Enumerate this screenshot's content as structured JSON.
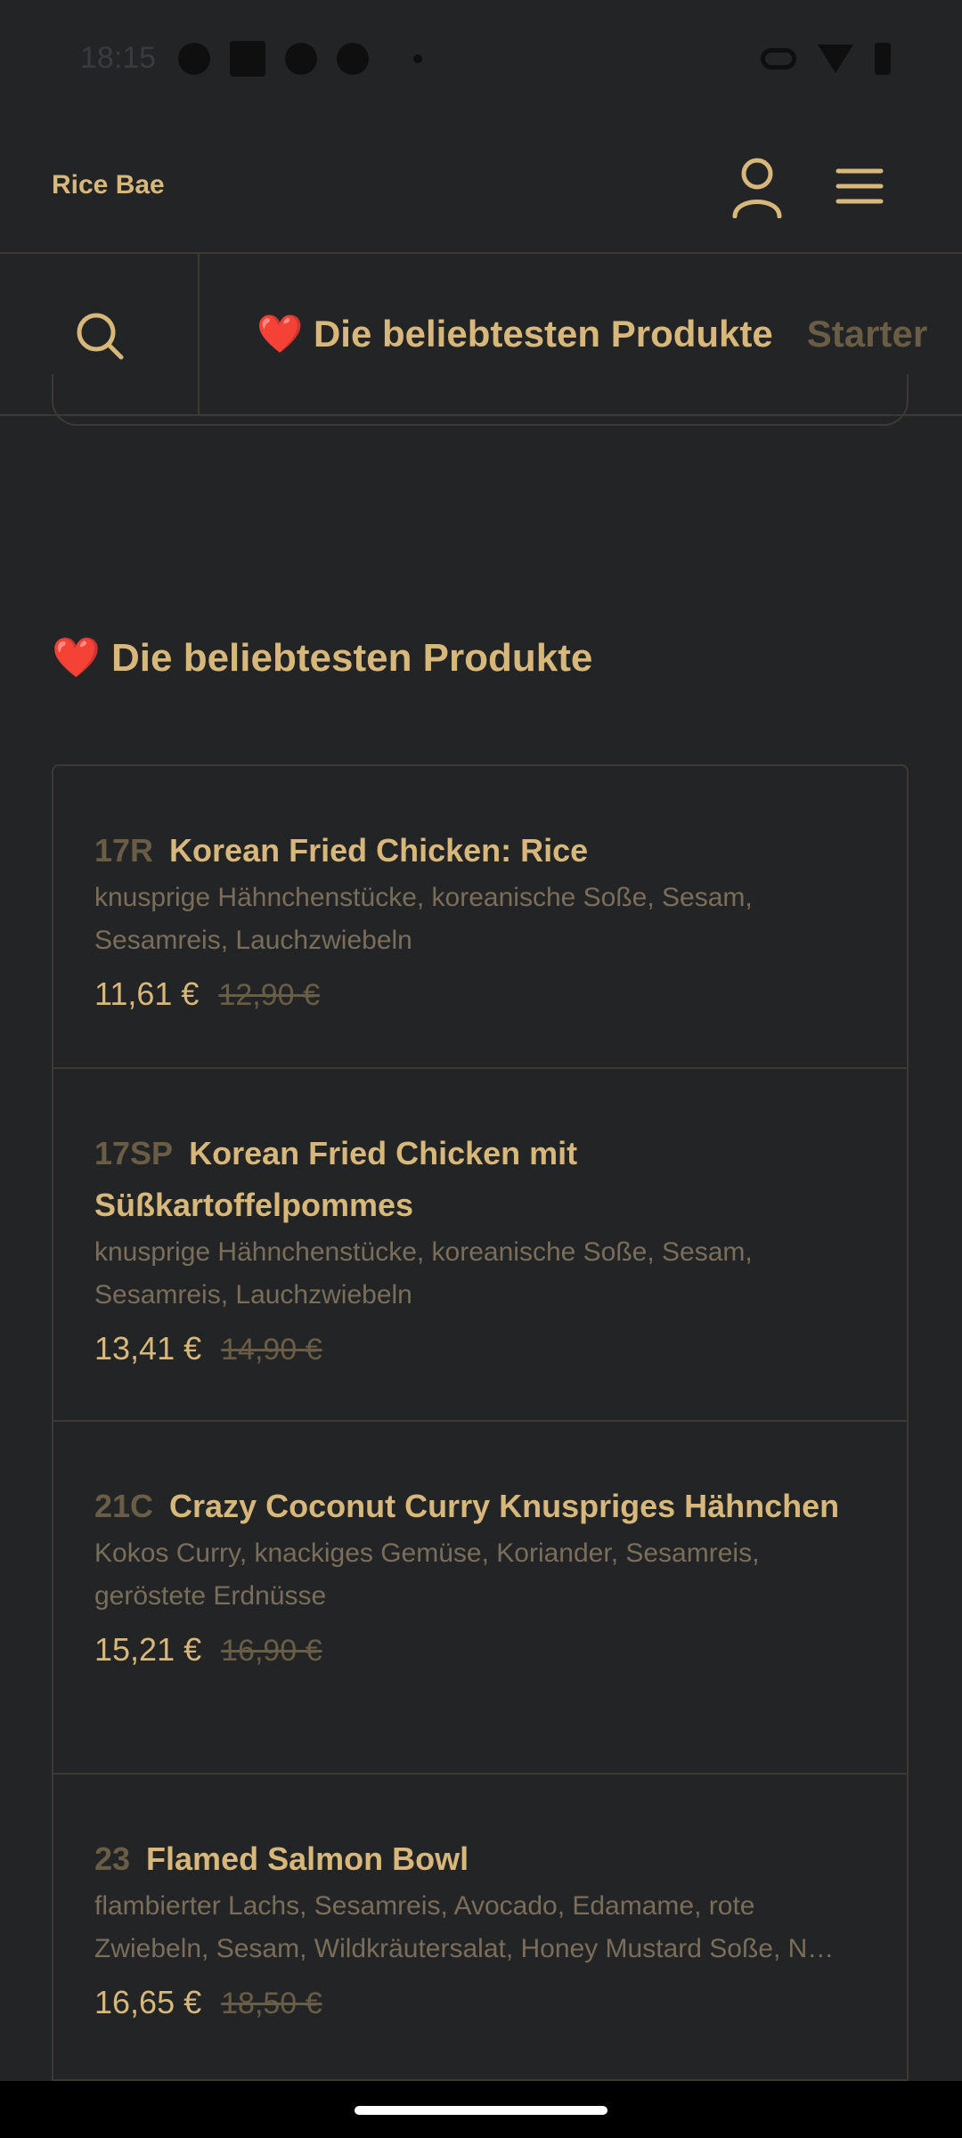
{
  "status_bar": {
    "time": "18:15"
  },
  "header": {
    "brand": "Rice Bae"
  },
  "category_bar": {
    "items": [
      {
        "label": "❤️ Die beliebtesten Produkte"
      },
      {
        "label": "Starter"
      }
    ]
  },
  "section": {
    "title": "❤️ Die beliebtesten Produkte"
  },
  "products": [
    {
      "code": "17R",
      "name": "Korean Fried Chicken: Rice",
      "description": "knusprige Hähnchenstücke, koreanische Soße, Sesam, Sesamreis, Lauchzwiebeln",
      "price": "11,61 €",
      "old_price": "12,90 €"
    },
    {
      "code": "17SP",
      "name": "Korean Fried Chicken mit Süßkartoffelpommes",
      "description": "knusprige Hähnchenstücke, koreanische Soße, Sesam, Sesamreis, Lauchzwiebeln",
      "price": "13,41 €",
      "old_price": "14,90 €"
    },
    {
      "code": "21C",
      "name": "Crazy Coconut Curry Knuspriges Hähnchen",
      "description": "Kokos Curry, knackiges Gemüse, Koriander, Sesamreis, geröstete Erdnüsse",
      "price": "15,21 €",
      "old_price": "16,90 €"
    },
    {
      "code": "23",
      "name": "Flamed Salmon Bowl",
      "description_line1": "flambierter Lachs, Sesamreis, Avocado, Edamame, rote",
      "description_line2": "Zwiebeln, Sesam, Wildkräutersalat, Honey Mustard Soße, N…",
      "price": "16,65 €",
      "old_price": "18,50 €"
    }
  ]
}
